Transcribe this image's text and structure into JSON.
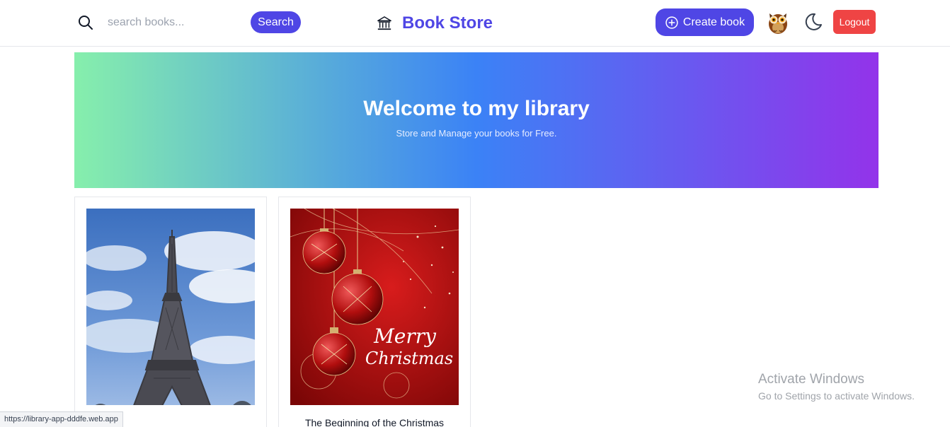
{
  "header": {
    "search_placeholder": "search books...",
    "search_button": "Search",
    "brand_title": "Book Store",
    "create_button": "Create book",
    "logout_button": "Logout",
    "icons": [
      "search-icon",
      "bank-icon",
      "plus-circle-icon",
      "owl-avatar",
      "moon-icon"
    ],
    "colors": {
      "primary": "#4f46e5",
      "danger": "#ef4444"
    }
  },
  "hero": {
    "title": "Welcome to my library",
    "subtitle": "Store and Manage your books for Free."
  },
  "books": [
    {
      "title": ""
    },
    {
      "title": "The Beginning of the Christmas"
    }
  ],
  "status_bar": {
    "url": "https://library-app-dddfe.web.app"
  },
  "watermark": {
    "title": "Activate Windows",
    "subtitle": "Go to Settings to activate Windows."
  }
}
